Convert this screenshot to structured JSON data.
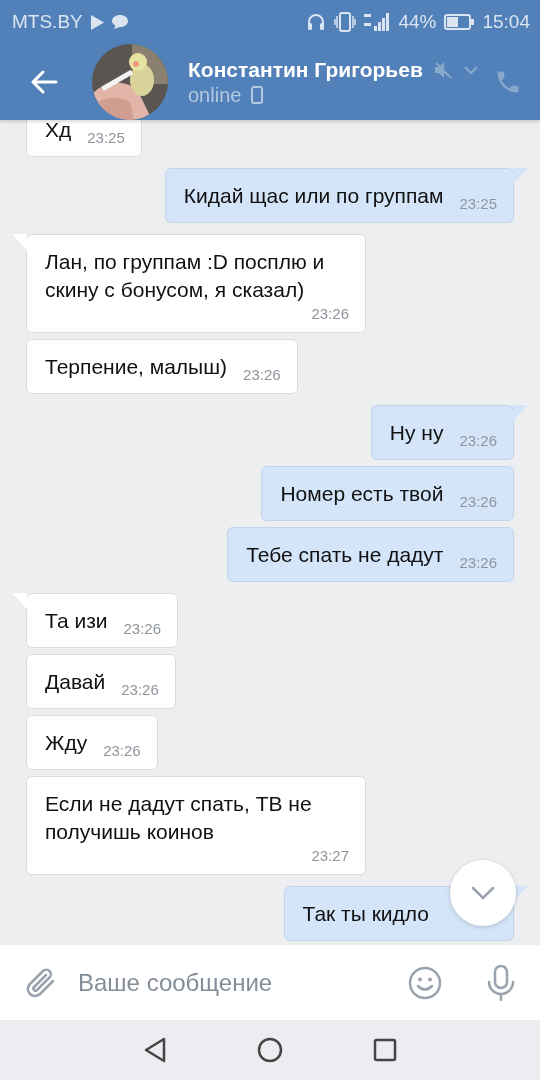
{
  "status_bar": {
    "carrier": "MTS.BY",
    "battery": "44%",
    "time": "15:04"
  },
  "header": {
    "name": "Константин Григорьев",
    "status": "online",
    "muted": true
  },
  "messages": [
    {
      "kind": "incoming",
      "tail": false,
      "text": "Хд",
      "time": "23:25"
    },
    {
      "kind": "outgoing",
      "tail": true,
      "text": "Кидай щас или по группам",
      "time": "23:25"
    },
    {
      "kind": "incoming",
      "tail": true,
      "text": "Лан, по группам :D посплю и скину с бонусом, я сказал)",
      "time": "23:26"
    },
    {
      "kind": "incoming",
      "tail": false,
      "text": "Терпение, малыш)",
      "time": "23:26"
    },
    {
      "kind": "outgoing",
      "tail": true,
      "text": "Ну ну",
      "time": "23:26"
    },
    {
      "kind": "outgoing",
      "tail": false,
      "text": "Номер есть твой",
      "time": "23:26"
    },
    {
      "kind": "outgoing",
      "tail": false,
      "text": "Тебе спать не дадут",
      "time": "23:26"
    },
    {
      "kind": "incoming",
      "tail": true,
      "text": "Та изи",
      "time": "23:26"
    },
    {
      "kind": "incoming",
      "tail": false,
      "text": "Давай",
      "time": "23:26"
    },
    {
      "kind": "incoming",
      "tail": false,
      "text": "Жду",
      "time": "23:26"
    },
    {
      "kind": "incoming",
      "tail": false,
      "text": "Если не дадут спать, ТВ не получишь коинов",
      "time": "23:27"
    },
    {
      "kind": "outgoing",
      "tail": true,
      "text": "Так ты кидло"
    }
  ],
  "composer": {
    "placeholder": "Ваше сообщение"
  }
}
